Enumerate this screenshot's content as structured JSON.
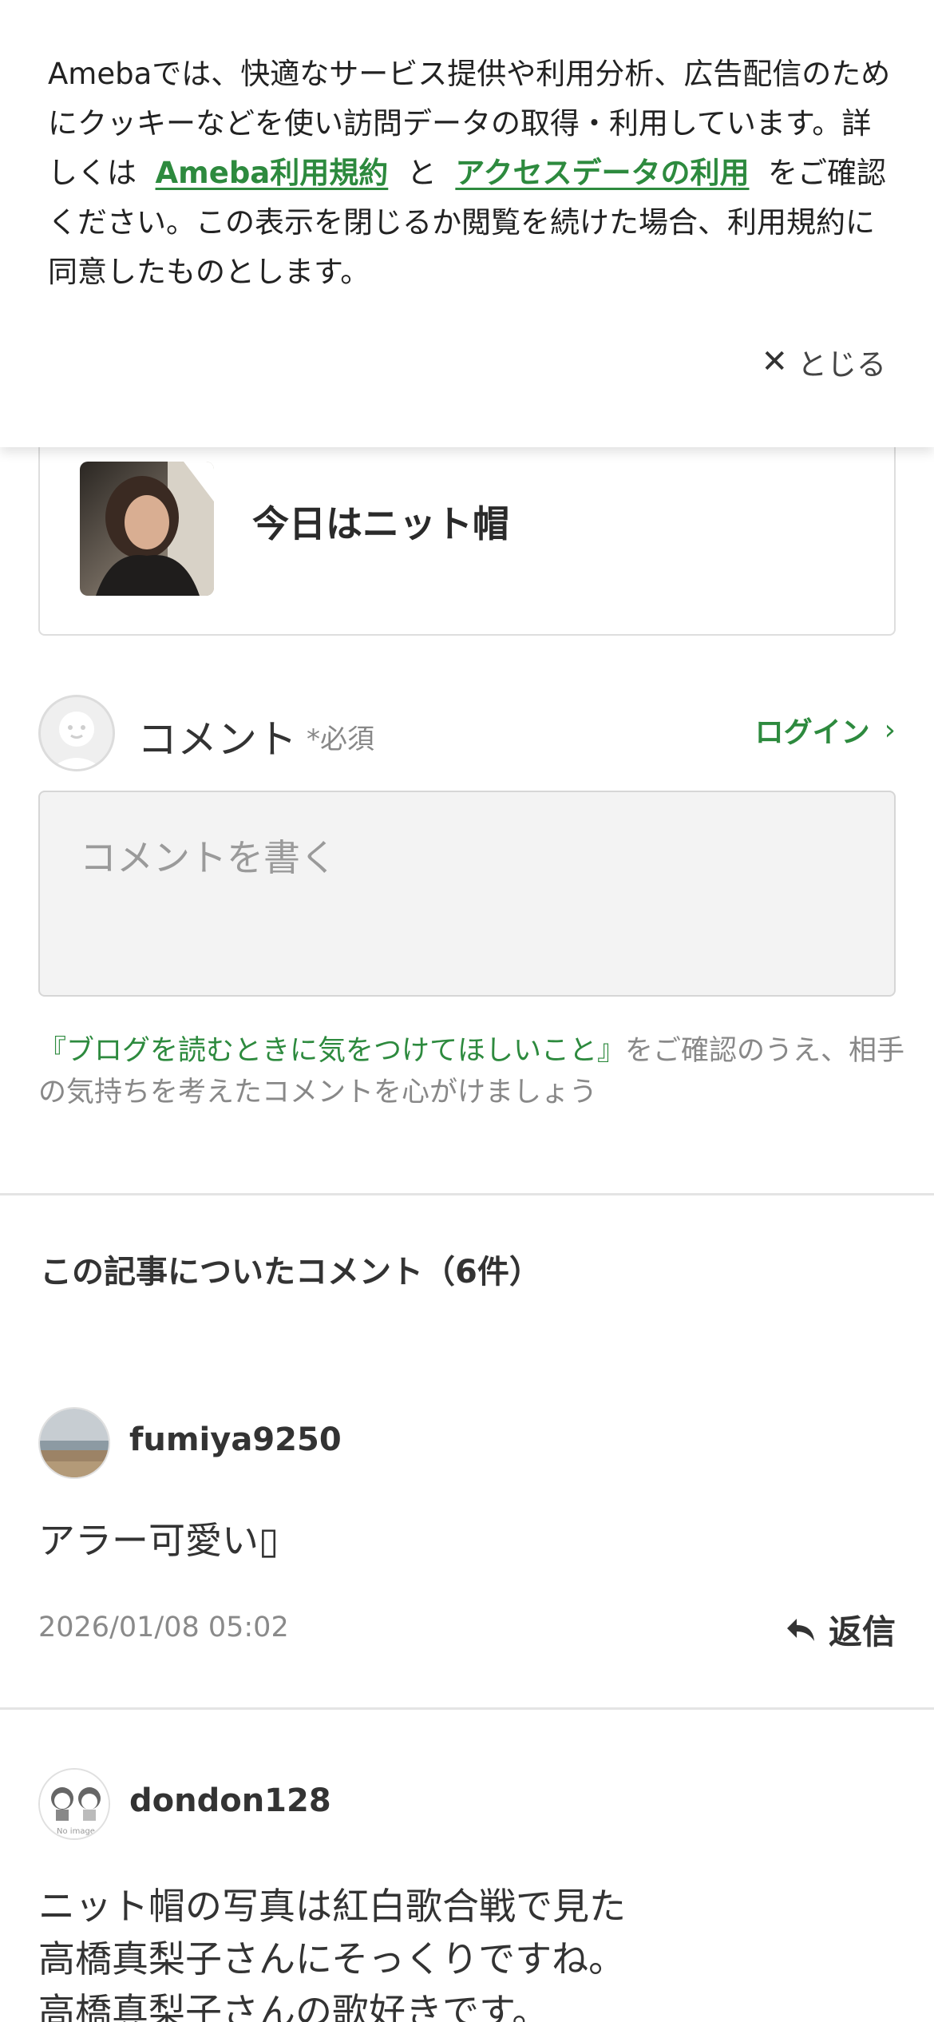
{
  "cookie_banner": {
    "text_1": "Amebaでは、快適なサービス提供や利用分析、広告配信のためにクッキーなどを使い訪問データの取得・利用しています。詳しくは",
    "link_terms": "Ameba利用規約",
    "text_and": "と",
    "link_access": "アクセスデータの利用",
    "text_2": "をご確認ください。この表示を閉じるか閲覧を続けた場合、利用規約に同意したものとします。",
    "close_label": "とじる",
    "close_icon": "close-icon"
  },
  "article": {
    "title": "今日はニット帽"
  },
  "comment_form": {
    "label": "コメント",
    "required": "*必須",
    "login": "ログイン",
    "placeholder": "コメントを書く",
    "guideline_link": "『ブログを読むときに気をつけてほしいこと』",
    "guideline_text": "をご確認のうえ、相手の気持ちを考えたコメントを心がけましょう"
  },
  "comments_section": {
    "title": "この記事についたコメント（6件）",
    "items": [
      {
        "user": "fumiya9250",
        "body": "アラー可愛い▯",
        "date": "2026/01/08 05:02",
        "reply": "返信"
      },
      {
        "user": "dondon128",
        "body": "ニット帽の写真は紅白歌合戦で見た\n高橋真梨子さんにそっくりですね。\n高橋真梨子さんの歌好きです。",
        "avatar_text": "No image"
      }
    ]
  },
  "colors": {
    "accent_green": "#2d8a3e",
    "text": "#333333",
    "muted": "#888888"
  }
}
